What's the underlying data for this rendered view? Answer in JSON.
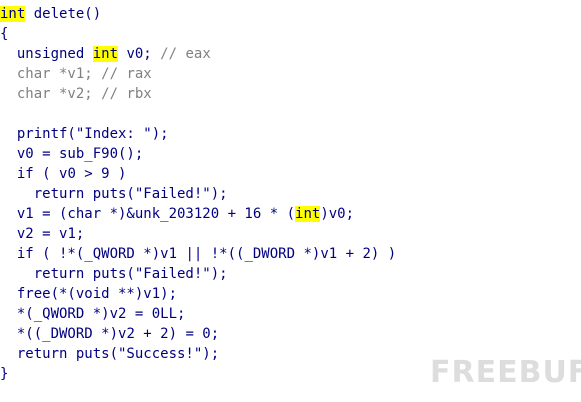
{
  "code_lines": [
    [
      {
        "t": "int",
        "c": "dark hl"
      },
      {
        "t": " delete()",
        "c": "dark"
      }
    ],
    [
      {
        "t": "{",
        "c": "dark"
      }
    ],
    [
      {
        "t": "  unsigned ",
        "c": "dark"
      },
      {
        "t": "int",
        "c": "dark hl"
      },
      {
        "t": " v0; ",
        "c": "dark"
      },
      {
        "t": "// eax",
        "c": "gray"
      }
    ],
    [
      {
        "t": "  char *v1; ",
        "c": "gray"
      },
      {
        "t": "// rax",
        "c": "gray"
      }
    ],
    [
      {
        "t": "  char *v2; ",
        "c": "gray"
      },
      {
        "t": "// rbx",
        "c": "gray"
      }
    ],
    [
      {
        "t": "",
        "c": "dark"
      }
    ],
    [
      {
        "t": "  printf(\"Index: \");",
        "c": "dark"
      }
    ],
    [
      {
        "t": "  ",
        "c": "dark"
      },
      {
        "t": "v0",
        "c": "var"
      },
      {
        "t": " = sub_F90();",
        "c": "dark"
      }
    ],
    [
      {
        "t": "  if ( ",
        "c": "dark"
      },
      {
        "t": "v0",
        "c": "var"
      },
      {
        "t": " > 9 )",
        "c": "dark"
      }
    ],
    [
      {
        "t": "    return puts(\"Failed!\");",
        "c": "dark"
      }
    ],
    [
      {
        "t": "  ",
        "c": "dark"
      },
      {
        "t": "v1",
        "c": "var"
      },
      {
        "t": " = (char *)&unk_203120 + 16 * (",
        "c": "dark"
      },
      {
        "t": "int",
        "c": "dark hl"
      },
      {
        "t": ")",
        "c": "dark"
      },
      {
        "t": "v0",
        "c": "var"
      },
      {
        "t": ";",
        "c": "dark"
      }
    ],
    [
      {
        "t": "  ",
        "c": "dark"
      },
      {
        "t": "v2",
        "c": "var"
      },
      {
        "t": " = ",
        "c": "dark"
      },
      {
        "t": "v1",
        "c": "var"
      },
      {
        "t": ";",
        "c": "dark"
      }
    ],
    [
      {
        "t": "  if ( !*(_QWORD *)",
        "c": "dark"
      },
      {
        "t": "v1",
        "c": "var"
      },
      {
        "t": " || !*((_DWORD *)",
        "c": "dark"
      },
      {
        "t": "v1",
        "c": "var"
      },
      {
        "t": " + 2) )",
        "c": "dark"
      }
    ],
    [
      {
        "t": "    return puts(\"Failed!\");",
        "c": "dark"
      }
    ],
    [
      {
        "t": "  free(*(void **)",
        "c": "dark"
      },
      {
        "t": "v1",
        "c": "var"
      },
      {
        "t": ");",
        "c": "dark"
      }
    ],
    [
      {
        "t": "  *(_QWORD *)",
        "c": "dark"
      },
      {
        "t": "v2",
        "c": "var"
      },
      {
        "t": " = 0LL;",
        "c": "dark"
      }
    ],
    [
      {
        "t": "  *((_DWORD *)",
        "c": "dark"
      },
      {
        "t": "v2",
        "c": "var"
      },
      {
        "t": " + 2) = 0;",
        "c": "dark"
      }
    ],
    [
      {
        "t": "  return puts(\"Success!\");",
        "c": "dark"
      }
    ],
    [
      {
        "t": "}",
        "c": "dark"
      }
    ]
  ],
  "colors": {
    "keyword": "#000080",
    "comment": "#808080",
    "highlight": "#ffff00",
    "background": "#ffffff"
  },
  "watermark": "FREEBUF"
}
